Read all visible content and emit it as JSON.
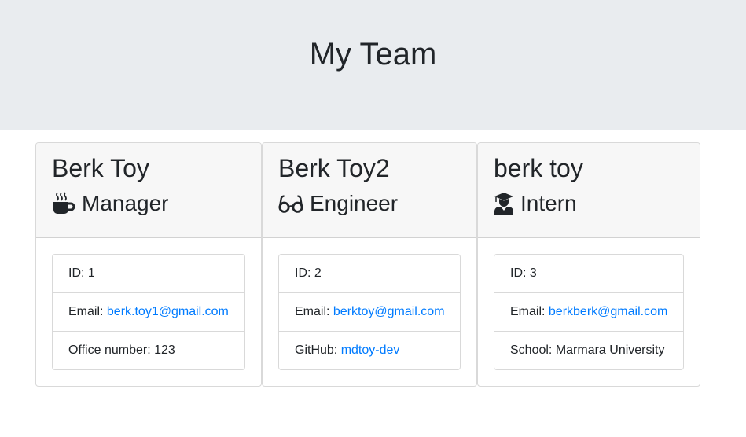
{
  "header": {
    "title": "My Team"
  },
  "colors": {
    "jumbotron_bg": "#e9ecef",
    "link": "#007bff",
    "card_header_bg": "#f7f7f7"
  },
  "cards": [
    {
      "name": "Berk Toy",
      "role": "Manager",
      "role_icon": "mug-hot-icon",
      "id_label": "ID: 1",
      "email_prefix": "Email: ",
      "email": "berk.toy1@gmail.com",
      "extra_prefix": "Office number: 123",
      "extra_link": ""
    },
    {
      "name": "Berk Toy2",
      "role": "Engineer",
      "role_icon": "glasses-icon",
      "id_label": "ID: 2",
      "email_prefix": "Email: ",
      "email": "berktoy@gmail.com",
      "extra_prefix": "GitHub: ",
      "extra_link": "mdtoy-dev"
    },
    {
      "name": "berk toy",
      "role": "Intern",
      "role_icon": "user-graduate-icon",
      "id_label": "ID: 3",
      "email_prefix": "Email: ",
      "email": "berkberk@gmail.com",
      "extra_prefix": "School: Marmara University",
      "extra_link": ""
    }
  ]
}
